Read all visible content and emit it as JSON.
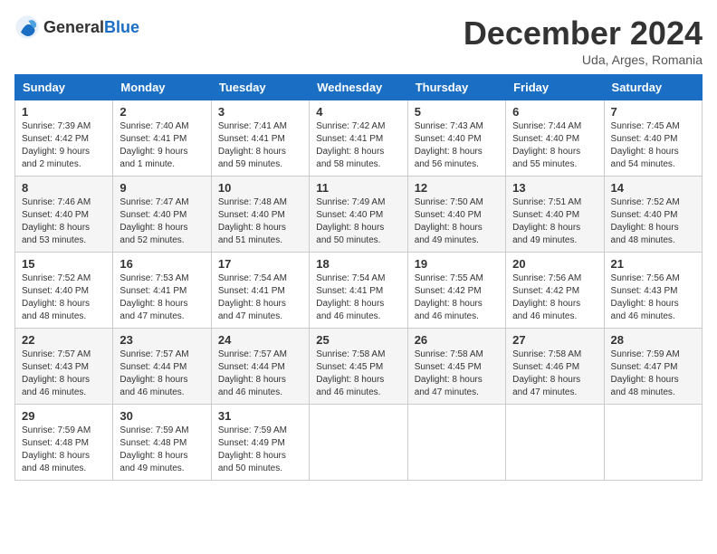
{
  "header": {
    "logo_general": "General",
    "logo_blue": "Blue",
    "title": "December 2024",
    "subtitle": "Uda, Arges, Romania"
  },
  "weekdays": [
    "Sunday",
    "Monday",
    "Tuesday",
    "Wednesday",
    "Thursday",
    "Friday",
    "Saturday"
  ],
  "weeks": [
    [
      {
        "day": "1",
        "sunrise": "Sunrise: 7:39 AM",
        "sunset": "Sunset: 4:42 PM",
        "daylight": "Daylight: 9 hours and 2 minutes."
      },
      {
        "day": "2",
        "sunrise": "Sunrise: 7:40 AM",
        "sunset": "Sunset: 4:41 PM",
        "daylight": "Daylight: 9 hours and 1 minute."
      },
      {
        "day": "3",
        "sunrise": "Sunrise: 7:41 AM",
        "sunset": "Sunset: 4:41 PM",
        "daylight": "Daylight: 8 hours and 59 minutes."
      },
      {
        "day": "4",
        "sunrise": "Sunrise: 7:42 AM",
        "sunset": "Sunset: 4:41 PM",
        "daylight": "Daylight: 8 hours and 58 minutes."
      },
      {
        "day": "5",
        "sunrise": "Sunrise: 7:43 AM",
        "sunset": "Sunset: 4:40 PM",
        "daylight": "Daylight: 8 hours and 56 minutes."
      },
      {
        "day": "6",
        "sunrise": "Sunrise: 7:44 AM",
        "sunset": "Sunset: 4:40 PM",
        "daylight": "Daylight: 8 hours and 55 minutes."
      },
      {
        "day": "7",
        "sunrise": "Sunrise: 7:45 AM",
        "sunset": "Sunset: 4:40 PM",
        "daylight": "Daylight: 8 hours and 54 minutes."
      }
    ],
    [
      {
        "day": "8",
        "sunrise": "Sunrise: 7:46 AM",
        "sunset": "Sunset: 4:40 PM",
        "daylight": "Daylight: 8 hours and 53 minutes."
      },
      {
        "day": "9",
        "sunrise": "Sunrise: 7:47 AM",
        "sunset": "Sunset: 4:40 PM",
        "daylight": "Daylight: 8 hours and 52 minutes."
      },
      {
        "day": "10",
        "sunrise": "Sunrise: 7:48 AM",
        "sunset": "Sunset: 4:40 PM",
        "daylight": "Daylight: 8 hours and 51 minutes."
      },
      {
        "day": "11",
        "sunrise": "Sunrise: 7:49 AM",
        "sunset": "Sunset: 4:40 PM",
        "daylight": "Daylight: 8 hours and 50 minutes."
      },
      {
        "day": "12",
        "sunrise": "Sunrise: 7:50 AM",
        "sunset": "Sunset: 4:40 PM",
        "daylight": "Daylight: 8 hours and 49 minutes."
      },
      {
        "day": "13",
        "sunrise": "Sunrise: 7:51 AM",
        "sunset": "Sunset: 4:40 PM",
        "daylight": "Daylight: 8 hours and 49 minutes."
      },
      {
        "day": "14",
        "sunrise": "Sunrise: 7:52 AM",
        "sunset": "Sunset: 4:40 PM",
        "daylight": "Daylight: 8 hours and 48 minutes."
      }
    ],
    [
      {
        "day": "15",
        "sunrise": "Sunrise: 7:52 AM",
        "sunset": "Sunset: 4:40 PM",
        "daylight": "Daylight: 8 hours and 48 minutes."
      },
      {
        "day": "16",
        "sunrise": "Sunrise: 7:53 AM",
        "sunset": "Sunset: 4:41 PM",
        "daylight": "Daylight: 8 hours and 47 minutes."
      },
      {
        "day": "17",
        "sunrise": "Sunrise: 7:54 AM",
        "sunset": "Sunset: 4:41 PM",
        "daylight": "Daylight: 8 hours and 47 minutes."
      },
      {
        "day": "18",
        "sunrise": "Sunrise: 7:54 AM",
        "sunset": "Sunset: 4:41 PM",
        "daylight": "Daylight: 8 hours and 46 minutes."
      },
      {
        "day": "19",
        "sunrise": "Sunrise: 7:55 AM",
        "sunset": "Sunset: 4:42 PM",
        "daylight": "Daylight: 8 hours and 46 minutes."
      },
      {
        "day": "20",
        "sunrise": "Sunrise: 7:56 AM",
        "sunset": "Sunset: 4:42 PM",
        "daylight": "Daylight: 8 hours and 46 minutes."
      },
      {
        "day": "21",
        "sunrise": "Sunrise: 7:56 AM",
        "sunset": "Sunset: 4:43 PM",
        "daylight": "Daylight: 8 hours and 46 minutes."
      }
    ],
    [
      {
        "day": "22",
        "sunrise": "Sunrise: 7:57 AM",
        "sunset": "Sunset: 4:43 PM",
        "daylight": "Daylight: 8 hours and 46 minutes."
      },
      {
        "day": "23",
        "sunrise": "Sunrise: 7:57 AM",
        "sunset": "Sunset: 4:44 PM",
        "daylight": "Daylight: 8 hours and 46 minutes."
      },
      {
        "day": "24",
        "sunrise": "Sunrise: 7:57 AM",
        "sunset": "Sunset: 4:44 PM",
        "daylight": "Daylight: 8 hours and 46 minutes."
      },
      {
        "day": "25",
        "sunrise": "Sunrise: 7:58 AM",
        "sunset": "Sunset: 4:45 PM",
        "daylight": "Daylight: 8 hours and 46 minutes."
      },
      {
        "day": "26",
        "sunrise": "Sunrise: 7:58 AM",
        "sunset": "Sunset: 4:45 PM",
        "daylight": "Daylight: 8 hours and 47 minutes."
      },
      {
        "day": "27",
        "sunrise": "Sunrise: 7:58 AM",
        "sunset": "Sunset: 4:46 PM",
        "daylight": "Daylight: 8 hours and 47 minutes."
      },
      {
        "day": "28",
        "sunrise": "Sunrise: 7:59 AM",
        "sunset": "Sunset: 4:47 PM",
        "daylight": "Daylight: 8 hours and 48 minutes."
      }
    ],
    [
      {
        "day": "29",
        "sunrise": "Sunrise: 7:59 AM",
        "sunset": "Sunset: 4:48 PM",
        "daylight": "Daylight: 8 hours and 48 minutes."
      },
      {
        "day": "30",
        "sunrise": "Sunrise: 7:59 AM",
        "sunset": "Sunset: 4:48 PM",
        "daylight": "Daylight: 8 hours and 49 minutes."
      },
      {
        "day": "31",
        "sunrise": "Sunrise: 7:59 AM",
        "sunset": "Sunset: 4:49 PM",
        "daylight": "Daylight: 8 hours and 50 minutes."
      },
      null,
      null,
      null,
      null
    ]
  ]
}
